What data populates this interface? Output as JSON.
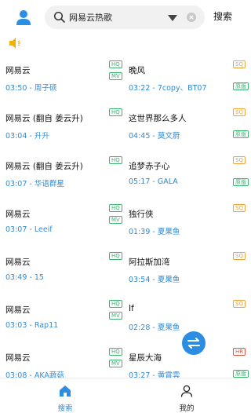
{
  "header": {
    "search_value": "网易云热歌",
    "search_placeholder": "网易云热歌",
    "search_button": "搜索"
  },
  "songs": [
    {
      "title": "网易云",
      "meta": "03:50 - 周子硕",
      "badges": [
        "HQ",
        "MV"
      ]
    },
    {
      "title": "晚风",
      "meta": "03:22 - 7copy、BT07",
      "badges": [
        "SQ",
        "原版"
      ]
    },
    {
      "title": "网易云 (翻自 姜云升)",
      "meta": "03:04 - 升升",
      "badges": [
        "HQ"
      ]
    },
    {
      "title": "这世界那么多人",
      "meta": "04:45 - 莫文蔚",
      "badges": [
        "SQ",
        "原版"
      ]
    },
    {
      "title": "网易云 (翻自 姜云升)",
      "meta": "03:07 - 华语群星",
      "badges": [
        "HQ"
      ]
    },
    {
      "title": "追梦赤子心",
      "meta": "05:17 - GALA",
      "badges": [
        "SQ",
        "原版"
      ]
    },
    {
      "title": "网易云",
      "meta": "03:07 - Leeif",
      "badges": [
        "HQ",
        "MV"
      ]
    },
    {
      "title": "独行侠",
      "meta": "01:39 - 夏果鱼",
      "badges": [
        "SQ"
      ]
    },
    {
      "title": "网易云",
      "meta": "03:49 - 15",
      "badges": [
        "HQ"
      ]
    },
    {
      "title": "阿拉斯加湾",
      "meta": "03:54 - 夏果鱼",
      "badges": [
        "SQ"
      ]
    },
    {
      "title": "网易云",
      "meta": "03:03 - Rap11",
      "badges": [
        "HQ",
        "MV"
      ]
    },
    {
      "title": "If",
      "meta": "02:28 - 夏果鱼",
      "badges": [
        "SQ"
      ]
    },
    {
      "title": "网易云",
      "meta": "03:08 - AKA蔬菇",
      "badges": [
        "HQ",
        "MV"
      ]
    },
    {
      "title": "星辰大海",
      "meta": "03:27 - 黄霄雲",
      "badges": [
        "HR",
        "原版"
      ]
    }
  ],
  "nav": {
    "search_label": "搜索",
    "mine_label": "我的"
  },
  "colors": {
    "accent": "#2b8ee3",
    "meta_text": "#2f8bd6",
    "badge_green": "#3cb371",
    "badge_orange": "#f0a53c",
    "badge_red": "#e0533c",
    "speaker": "#f2b300"
  },
  "icons": {
    "avatar": "person-icon",
    "search": "search-icon",
    "dropdown": "caret-down-icon",
    "clear": "clear-icon",
    "speaker": "speaker-icon",
    "fab": "swap-arrows-icon",
    "nav_search": "home-icon",
    "nav_mine": "user-outline-icon"
  }
}
